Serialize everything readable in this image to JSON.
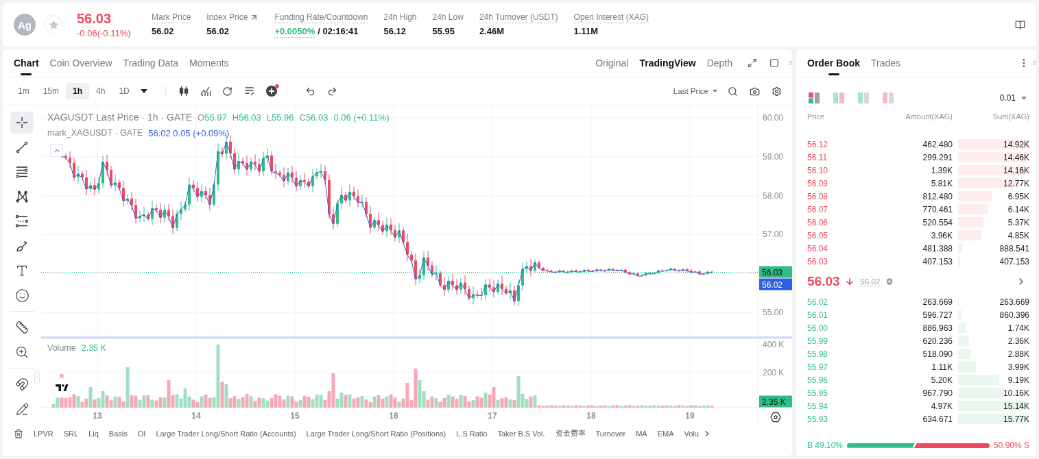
{
  "header": {
    "symbol": "Ag",
    "favorite": false,
    "price": "56.03",
    "change": "-0.06(-0.11%)",
    "falling": true,
    "stats": [
      {
        "kind": "plain",
        "label": "Mark Price",
        "value": "56.02",
        "hint": true,
        "link": false
      },
      {
        "kind": "plain",
        "label": "Index Price",
        "value": "56.02",
        "hint": false,
        "link": true
      },
      {
        "kind": "funding",
        "label": "Funding Rate/Countdown",
        "value": "+0.0050%",
        "countdown": "/ 02:16:41",
        "hint": true,
        "link": false
      },
      {
        "kind": "plain",
        "label": "24h High",
        "value": "56.12",
        "hint": false,
        "link": false
      },
      {
        "kind": "plain",
        "label": "24h Low",
        "value": "55.95",
        "hint": false,
        "link": false
      },
      {
        "kind": "plain",
        "label": "24h Turnover (USDT)",
        "value": "2.46M",
        "hint": true,
        "link": false
      },
      {
        "kind": "plain",
        "label": "Open Interest (XAG)",
        "value": "1.11M",
        "hint": true,
        "link": false
      }
    ]
  },
  "chart": {
    "tabs": [
      {
        "label": "Chart",
        "selected": true
      },
      {
        "label": "Coin Overview",
        "selected": false
      },
      {
        "label": "Trading Data",
        "selected": false
      },
      {
        "label": "Moments",
        "selected": false
      }
    ],
    "views": [
      {
        "label": "Original",
        "selected": false
      },
      {
        "label": "TradingView",
        "selected": true
      },
      {
        "label": "Depth",
        "selected": false
      }
    ],
    "intervals": [
      {
        "label": "1m",
        "selected": false
      },
      {
        "label": "15m",
        "selected": false
      },
      {
        "label": "1h",
        "selected": true
      },
      {
        "label": "4h",
        "selected": false
      },
      {
        "label": "1D",
        "selected": false
      }
    ],
    "indicator_badge": true,
    "price_source": "Last Price",
    "tool_groups": [
      [
        {
          "kind": "crosshair",
          "selected": true
        },
        {
          "kind": "trend-line",
          "selected": false
        },
        {
          "kind": "parallel-lines",
          "selected": false
        },
        {
          "kind": "pattern",
          "selected": false
        },
        {
          "kind": "fib-lines",
          "selected": false
        },
        {
          "kind": "brush",
          "selected": false
        },
        {
          "kind": "text",
          "selected": false
        },
        {
          "kind": "emoji",
          "selected": false
        }
      ],
      [
        {
          "kind": "ruler",
          "selected": false
        },
        {
          "kind": "zoom",
          "selected": false
        }
      ],
      [
        {
          "kind": "magnet",
          "selected": false
        },
        {
          "kind": "pencil",
          "selected": false
        }
      ]
    ],
    "legend": {
      "title": "XAGUSDT Last Price · 1h · GATE",
      "ohlc": [
        {
          "key": "O",
          "value": "55.97"
        },
        {
          "key": "H",
          "value": "56.03"
        },
        {
          "key": "L",
          "value": "55.96"
        },
        {
          "key": "C",
          "value": "56.03"
        }
      ],
      "change": "0.06 (+0.11%)",
      "falling": false
    },
    "mark_legend": {
      "title": "mark_XAGUSDT · GATE",
      "value": "56.02 0.05 (+0.09%)"
    },
    "volume_legend": {
      "title": "Volume",
      "value": "2.35 K"
    },
    "price_axis": [
      "60.00",
      "59.00",
      "58.00",
      "57.00",
      "55.00"
    ],
    "volume_axis": [
      "400 K",
      "200 K"
    ],
    "last_price_tag": "56.03",
    "mark_price_tag": "56.02",
    "volume_tag": "2.35 K",
    "time_axis": [
      "13",
      "14",
      "15",
      "16",
      "17",
      "18",
      "19"
    ],
    "indicators": [
      "LPVR",
      "SRL",
      "Liq",
      "Basis",
      "OI",
      "Large Trader Long/Short Ratio (Accounts)",
      "Large Trader Long/Short Ratio (Positions)",
      "L.S Ratio",
      "Taker B.S Vol.",
      "资金费率",
      "Turnover",
      "MA",
      "EMA",
      "Volu"
    ]
  },
  "order_book": {
    "tabs": [
      {
        "label": "Order Book",
        "selected": true
      },
      {
        "label": "Trades",
        "selected": false
      }
    ],
    "layouts": [
      {
        "kind": "both",
        "selected": true
      },
      {
        "kind": "split",
        "selected": false
      },
      {
        "kind": "bids",
        "selected": false
      },
      {
        "kind": "asks",
        "selected": false
      }
    ],
    "precision": "0.01",
    "columns": [
      "Price",
      "Amount(XAG)",
      "Sum(XAG)"
    ],
    "asks": [
      {
        "price": "56.12",
        "amount": "462.480",
        "sum": "14.92K",
        "level": 1.0
      },
      {
        "price": "56.11",
        "amount": "299.291",
        "sum": "14.46K",
        "level": 0.97
      },
      {
        "price": "56.10",
        "amount": "1.39K",
        "sum": "14.16K",
        "level": 0.95
      },
      {
        "price": "56.09",
        "amount": "5.81K",
        "sum": "12.77K",
        "level": 0.86
      },
      {
        "price": "56.08",
        "amount": "812.480",
        "sum": "6.95K",
        "level": 0.47
      },
      {
        "price": "56.07",
        "amount": "770.461",
        "sum": "6.14K",
        "level": 0.41
      },
      {
        "price": "56.06",
        "amount": "520.554",
        "sum": "5.37K",
        "level": 0.36
      },
      {
        "price": "56.05",
        "amount": "3.96K",
        "sum": "4.85K",
        "level": 0.33
      },
      {
        "price": "56.04",
        "amount": "481.388",
        "sum": "888.541",
        "level": 0.06
      },
      {
        "price": "56.03",
        "amount": "407.153",
        "sum": "407.153",
        "level": 0.03
      }
    ],
    "last": {
      "price": "56.03",
      "falling": true,
      "mark": "56.02"
    },
    "bids": [
      {
        "price": "56.02",
        "amount": "263.669",
        "sum": "263.669",
        "level": 0.02
      },
      {
        "price": "56.01",
        "amount": "596.727",
        "sum": "860.396",
        "level": 0.05
      },
      {
        "price": "56.00",
        "amount": "886.963",
        "sum": "1.74K",
        "level": 0.11
      },
      {
        "price": "55.99",
        "amount": "620.236",
        "sum": "2.36K",
        "level": 0.15
      },
      {
        "price": "55.98",
        "amount": "518.090",
        "sum": "2.88K",
        "level": 0.18
      },
      {
        "price": "55.97",
        "amount": "1.11K",
        "sum": "3.99K",
        "level": 0.25
      },
      {
        "price": "55.96",
        "amount": "5.20K",
        "sum": "9.19K",
        "level": 0.58
      },
      {
        "price": "55.95",
        "amount": "967.790",
        "sum": "10.16K",
        "level": 0.64
      },
      {
        "price": "55.94",
        "amount": "4.97K",
        "sum": "15.14K",
        "level": 0.96
      },
      {
        "price": "55.93",
        "amount": "634.671",
        "sum": "15.77K",
        "level": 1.0
      }
    ],
    "ratio": {
      "buy": "B 49.10%",
      "sell": "50.90% S",
      "level": 0.491
    }
  }
}
